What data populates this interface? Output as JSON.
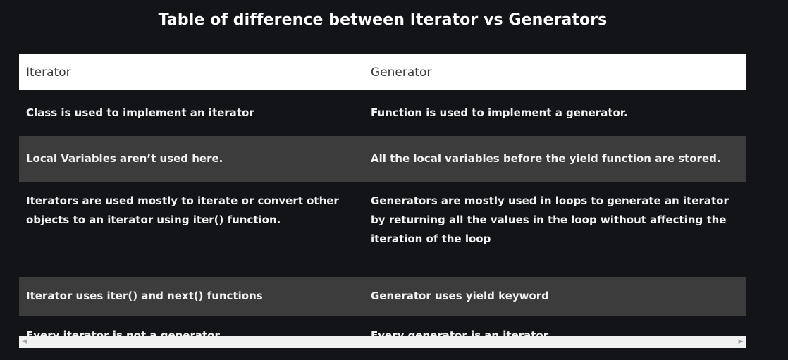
{
  "title": "Table of difference between Iterator vs Generators",
  "table": {
    "headers": [
      "Iterator",
      "Generator"
    ],
    "rows": [
      [
        "Class is used to implement an iterator",
        "Function is used to implement a generator."
      ],
      [
        "Local Variables aren’t used here.",
        "All the local variables before the yield function are stored."
      ],
      [
        "Iterators are used mostly to iterate or convert other objects to an iterator using iter() function.",
        "Generators are mostly used in loops to generate an iterator by returning all the values in the loop without affecting the iteration of the loop"
      ],
      [
        "Iterator uses iter() and next() functions",
        "Generator uses yield keyword"
      ],
      [
        "Every iterator is not a generator",
        "Every generator is an iterator"
      ]
    ]
  },
  "scrollbar": {
    "left_arrow_icon": "triangle-left-icon",
    "right_arrow_icon": "triangle-right-icon"
  },
  "colors": {
    "background": "#131417",
    "header_bg": "#ffffff",
    "alt_row_bg": "#3c3c3c"
  }
}
